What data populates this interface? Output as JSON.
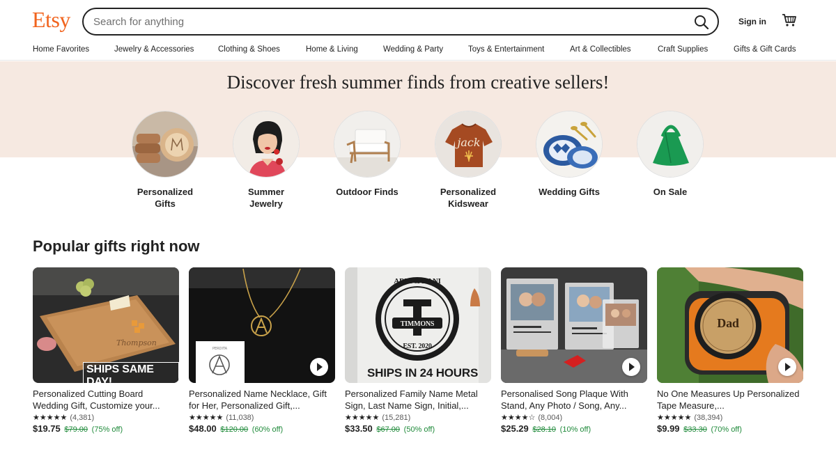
{
  "header": {
    "logo": "Etsy",
    "search_placeholder": "Search for anything",
    "signin": "Sign in"
  },
  "categories": [
    "Home Favorites",
    "Jewelry & Accessories",
    "Clothing & Shoes",
    "Home & Living",
    "Wedding & Party",
    "Toys & Entertainment",
    "Art & Collectibles",
    "Craft Supplies",
    "Gifts & Gift Cards"
  ],
  "banner": {
    "headline": "Discover fresh summer finds from creative sellers!",
    "items": [
      {
        "label": "Personalized\nGifts",
        "icon": "wooden-bowls-image"
      },
      {
        "label": "Summer\nJewelry",
        "icon": "woman-portrait-image"
      },
      {
        "label": "Outdoor Finds",
        "icon": "outdoor-chair-image"
      },
      {
        "label": "Personalized\nKidswear",
        "icon": "kids-sweater-image"
      },
      {
        "label": "Wedding Gifts",
        "icon": "blue-plates-image"
      },
      {
        "label": "On Sale",
        "icon": "green-bag-image"
      }
    ]
  },
  "popular": {
    "title": "Popular gifts right now",
    "products": [
      {
        "title": "Personalized Cutting Board Wedding Gift, Customize your...",
        "stars": "★★★★★",
        "reviews": "(4,381)",
        "price": "$19.75",
        "original_price": "$79.00",
        "discount": "(75% off)",
        "overlay": "SHIPS SAME DAY!",
        "has_video": false
      },
      {
        "title": "Personalized Name Necklace, Gift for Her, Personalized Gift,...",
        "stars": "★★★★★",
        "reviews": "(11,038)",
        "price": "$48.00",
        "original_price": "$120.00",
        "discount": "(60% off)",
        "overlay": "",
        "has_video": true
      },
      {
        "title": "Personalized Family Name Metal Sign, Last Name Sign, Initial,...",
        "stars": "★★★★★",
        "reviews": "(15,281)",
        "price": "$33.50",
        "original_price": "$67.00",
        "discount": "(50% off)",
        "overlay": "SHIPS IN 24 HOURS",
        "sign_top": "ABBI & DANI",
        "sign_letter": "T",
        "sign_name": "TIMMONS",
        "sign_est": "EST. 2020",
        "has_video": false
      },
      {
        "title": "Personalised Song Plaque With Stand, Any Photo / Song, Any...",
        "stars": "★★★★☆",
        "reviews": "(8,004)",
        "price": "$25.29",
        "original_price": "$28.10",
        "discount": "(10% off)",
        "overlay": "",
        "has_video": true
      },
      {
        "title": "No One Measures Up Personalized Tape Measure,...",
        "stars": "★★★★★",
        "reviews": "(38,394)",
        "price": "$9.99",
        "original_price": "$33.30",
        "discount": "(70% off)",
        "overlay": "",
        "tape_text": "Dad",
        "has_video": true
      }
    ]
  },
  "colors": {
    "brand": "#F1641E",
    "banner_bg": "#f6e9e1",
    "discount_green": "#1f8a3a"
  }
}
